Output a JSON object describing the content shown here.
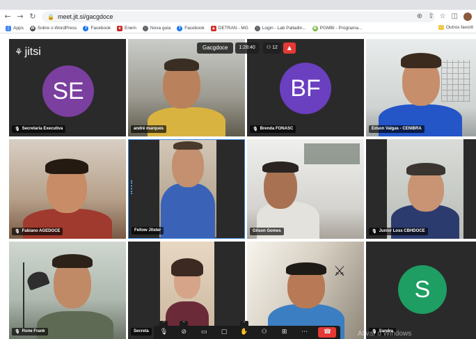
{
  "browser": {
    "url": "meet.jit.si/gacgdoce",
    "bookmarks": [
      {
        "label": "Apps",
        "icon": "apps-grid-icon",
        "color": "#4285f4"
      },
      {
        "label": "Sobre o WordPress",
        "icon": "wordpress-icon",
        "color": "#464646"
      },
      {
        "label": "Facebook",
        "icon": "facebook-icon",
        "color": "#1877f2"
      },
      {
        "label": "Enem",
        "icon": "enem-icon",
        "color": "#c62828"
      },
      {
        "label": "Nova guia",
        "icon": "globe-icon",
        "color": "#5f6368"
      },
      {
        "label": "Facebook",
        "icon": "facebook-icon",
        "color": "#1877f2"
      },
      {
        "label": "DETRAN - MG",
        "icon": "detran-icon",
        "color": "#d32f2f"
      },
      {
        "label": "Login - Lab Palladin...",
        "icon": "globe-icon",
        "color": "#5f6368"
      },
      {
        "label": "PGMBI - Programa...",
        "icon": "pgmbi-icon",
        "color": "#7cb342"
      }
    ],
    "other_bookmarks": "Outros favorit"
  },
  "meeting": {
    "logo": "jitsi",
    "title": "Gacgdoce",
    "timer": "1:28:40",
    "participants_count": "12",
    "alert_icon": "warning-icon",
    "watermark": "Ativar o Windows"
  },
  "tiles": [
    {
      "name": "Secretaria Executiva",
      "initials": "SE",
      "type": "avatar",
      "avatar_color": "#7b3fa0",
      "muted": true
    },
    {
      "name": "andré marques",
      "type": "video",
      "muted": false
    },
    {
      "name": "Brenda FONASC",
      "initials": "BF",
      "type": "avatar",
      "avatar_color": "#6a3fc0",
      "muted": true
    },
    {
      "name": "Edson Valgas - CENIBRA",
      "type": "video",
      "muted": false
    },
    {
      "name": "Fabiano AGEDOCE",
      "type": "video",
      "muted": true
    },
    {
      "name": "Fellow Jitster",
      "type": "video",
      "muted": false,
      "active": true
    },
    {
      "name": "Gilson Gomes",
      "type": "video",
      "muted": false
    },
    {
      "name": "Junior Loss CBHDOCE",
      "type": "video",
      "muted": true
    },
    {
      "name": "Rone Frank",
      "type": "video",
      "muted": true
    },
    {
      "name": "Secreta",
      "type": "video",
      "muted": false
    },
    {
      "name": "",
      "type": "video",
      "muted": false
    },
    {
      "name": "Sandra",
      "initials": "S",
      "type": "avatar",
      "avatar_color": "#1e9e62",
      "muted": true
    }
  ],
  "toolbar": [
    {
      "icon": "microphone-muted-icon",
      "glyph": "🎙"
    },
    {
      "icon": "camera-muted-icon",
      "glyph": "⊘"
    },
    {
      "icon": "screen-share-icon",
      "glyph": "▭"
    },
    {
      "icon": "chat-icon",
      "glyph": "▢"
    },
    {
      "icon": "raise-hand-icon",
      "glyph": "✋"
    },
    {
      "icon": "participants-icon",
      "glyph": "⚇"
    },
    {
      "icon": "tile-view-icon",
      "glyph": "⊞"
    },
    {
      "icon": "more-options-icon",
      "glyph": "⋯"
    },
    {
      "icon": "hangup-icon",
      "glyph": "☎"
    }
  ]
}
